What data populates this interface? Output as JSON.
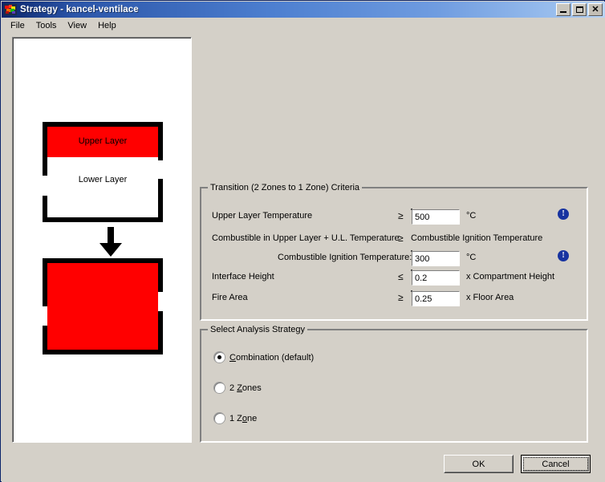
{
  "window": {
    "title": "Strategy - kancel-ventilace",
    "icon": "app-icon",
    "buttons": {
      "minimize": "minimize-icon",
      "maximize": "maximize-icon",
      "close": "✕"
    }
  },
  "menu": {
    "items": [
      {
        "label": "File"
      },
      {
        "label": "Tools"
      },
      {
        "label": "View"
      },
      {
        "label": "Help"
      }
    ]
  },
  "illustration": {
    "upper_layer_label": "Upper Layer",
    "lower_layer_label": "Lower Layer",
    "arrow": "down-arrow-icon",
    "upper_layer_color": "#ff0000",
    "lower_layer_color": "#ffffff",
    "one_zone_color": "#ff0000"
  },
  "transition_group": {
    "title": "Transition (2 Zones to 1 Zone) Criteria",
    "rows": [
      {
        "label": "Upper Layer Temperature",
        "operator": "≥",
        "value": "500",
        "unit": "°C",
        "info": true
      },
      {
        "label": "Combustible in Upper Layer + U.L. Temperature",
        "operator": "≥",
        "value_text": "Combustible Ignition Temperature"
      },
      {
        "label": "Combustible Ignition Temperature:",
        "value": "300",
        "unit": "°C",
        "info": true
      },
      {
        "label": "Interface Height",
        "operator": "≤",
        "value": "0.2",
        "unit": "x Compartment Height"
      },
      {
        "label": "Fire Area",
        "operator": "≥",
        "value": "0.25",
        "unit": "x Floor Area"
      }
    ]
  },
  "strategy_group": {
    "title": "Select Analysis Strategy",
    "options": [
      {
        "label_pre": "",
        "accel": "C",
        "label_post": "ombination (default)",
        "selected": true
      },
      {
        "label_pre": "2 ",
        "accel": "Z",
        "label_post": "ones",
        "selected": false
      },
      {
        "label_pre": "1 Z",
        "accel": "o",
        "label_post": "ne",
        "selected": false
      }
    ]
  },
  "footer": {
    "ok_label": "OK",
    "cancel_label": "Cancel"
  }
}
